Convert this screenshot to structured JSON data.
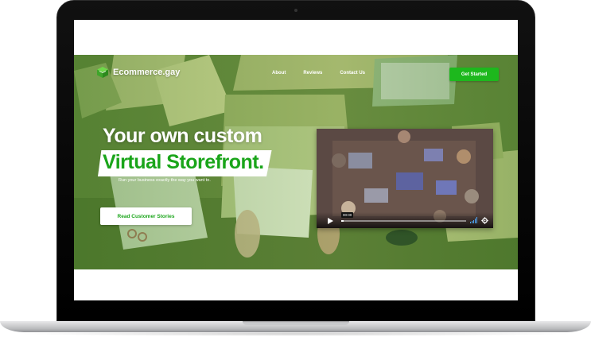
{
  "site": {
    "brand": "Ecommerce.gay",
    "nav": [
      {
        "label": "About"
      },
      {
        "label": "Reviews"
      },
      {
        "label": "Contact Us"
      }
    ],
    "cta_label": "Get Started"
  },
  "hero": {
    "headline_line1": "Your own custom",
    "headline_line2": "Virtual Storefront.",
    "subtext": "Run your business exactly the way you want to.",
    "button_label": "Read Customer Stories"
  },
  "video": {
    "time": "00:00",
    "progress": 0.02,
    "icons": [
      "play-icon",
      "volume-icon",
      "settings-icon"
    ]
  },
  "colors": {
    "accent_green": "#1db81d",
    "headline_green": "#1aa51a",
    "hero_tint": "#6f8f43"
  }
}
